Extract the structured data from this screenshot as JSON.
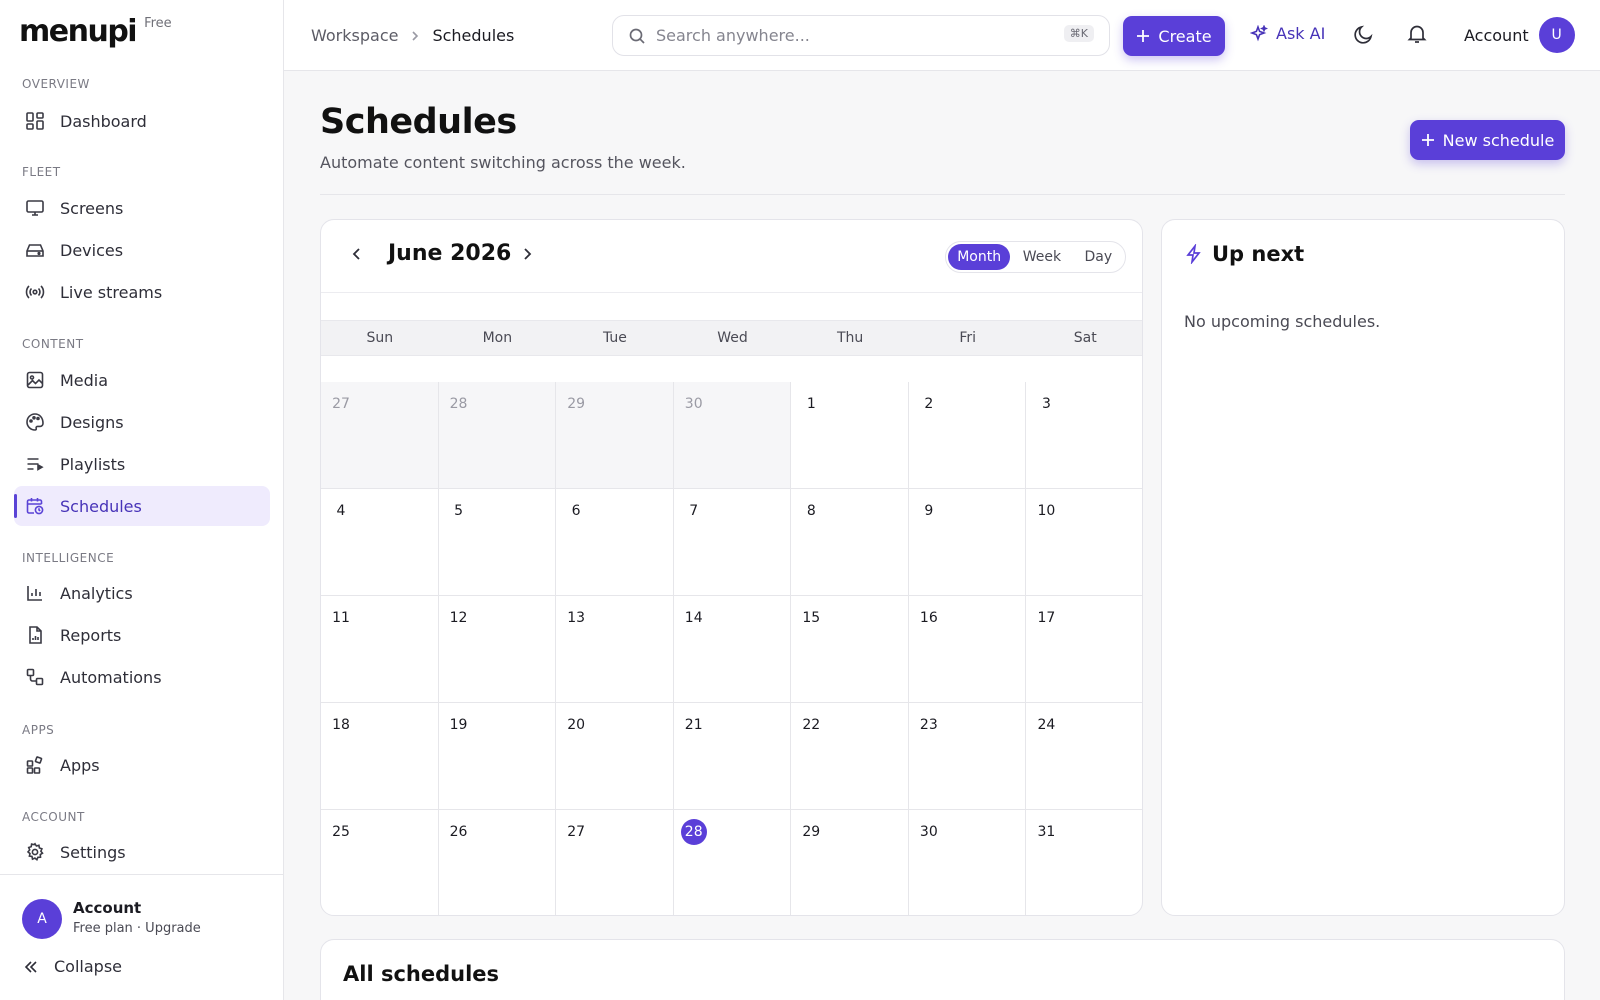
{
  "brand": {
    "name": "menupi",
    "badge": "Free"
  },
  "sidebar": {
    "sections": [
      {
        "label": "Overview",
        "items": [
          {
            "label": "Dashboard",
            "icon": "dashboard-icon"
          }
        ]
      },
      {
        "label": "Fleet",
        "items": [
          {
            "label": "Screens",
            "icon": "monitor-icon"
          },
          {
            "label": "Devices",
            "icon": "device-icon"
          },
          {
            "label": "Live streams",
            "icon": "broadcast-icon"
          }
        ]
      },
      {
        "label": "Content",
        "items": [
          {
            "label": "Media",
            "icon": "image-icon"
          },
          {
            "label": "Designs",
            "icon": "palette-icon"
          },
          {
            "label": "Playlists",
            "icon": "playlist-icon"
          },
          {
            "label": "Schedules",
            "icon": "calendar-clock-icon",
            "active": true
          }
        ]
      },
      {
        "label": "Intelligence",
        "items": [
          {
            "label": "Analytics",
            "icon": "bar-chart-icon"
          },
          {
            "label": "Reports",
            "icon": "report-icon"
          },
          {
            "label": "Automations",
            "icon": "workflow-icon"
          }
        ]
      },
      {
        "label": "Apps",
        "items": [
          {
            "label": "Apps",
            "icon": "apps-icon"
          }
        ]
      },
      {
        "label": "Account",
        "items": [
          {
            "label": "Settings",
            "icon": "gear-icon"
          }
        ]
      }
    ],
    "footer": {
      "avatar": "A",
      "name": "Account",
      "plan": "Free plan · Upgrade",
      "collapse": "Collapse"
    }
  },
  "topbar": {
    "breadcrumb": [
      "Workspace",
      "Schedules"
    ],
    "search_placeholder": "Search anywhere...",
    "shortcut": "⌘K",
    "create": "Create",
    "ask_ai": "Ask AI",
    "account": "Account",
    "account_avatar": "U"
  },
  "page": {
    "title": "Schedules",
    "subtitle": "Automate content switching across the week.",
    "new_button": "New schedule"
  },
  "calendar": {
    "month": "June 2026",
    "views": [
      "Month",
      "Week",
      "Day"
    ],
    "active_view": "Month",
    "weekdays": [
      "Sun",
      "Mon",
      "Tue",
      "Wed",
      "Thu",
      "Fri",
      "Sat"
    ],
    "days": [
      {
        "d": "27",
        "muted": true
      },
      {
        "d": "28",
        "muted": true
      },
      {
        "d": "29",
        "muted": true
      },
      {
        "d": "30",
        "muted": true
      },
      {
        "d": "1"
      },
      {
        "d": "2"
      },
      {
        "d": "3"
      },
      {
        "d": "4"
      },
      {
        "d": "5"
      },
      {
        "d": "6"
      },
      {
        "d": "7"
      },
      {
        "d": "8"
      },
      {
        "d": "9"
      },
      {
        "d": "10"
      },
      {
        "d": "11"
      },
      {
        "d": "12"
      },
      {
        "d": "13"
      },
      {
        "d": "14"
      },
      {
        "d": "15"
      },
      {
        "d": "16"
      },
      {
        "d": "17"
      },
      {
        "d": "18"
      },
      {
        "d": "19"
      },
      {
        "d": "20"
      },
      {
        "d": "21"
      },
      {
        "d": "22"
      },
      {
        "d": "23"
      },
      {
        "d": "24"
      },
      {
        "d": "25"
      },
      {
        "d": "26"
      },
      {
        "d": "27"
      },
      {
        "d": "28",
        "today": true
      },
      {
        "d": "29"
      },
      {
        "d": "30"
      },
      {
        "d": "31"
      }
    ]
  },
  "up_next": {
    "title": "Up next",
    "empty": "No upcoming schedules."
  },
  "all_schedules": {
    "title": "All schedules"
  },
  "colors": {
    "accent": "#5a3fd8",
    "accent_soft": "#efebfd"
  }
}
